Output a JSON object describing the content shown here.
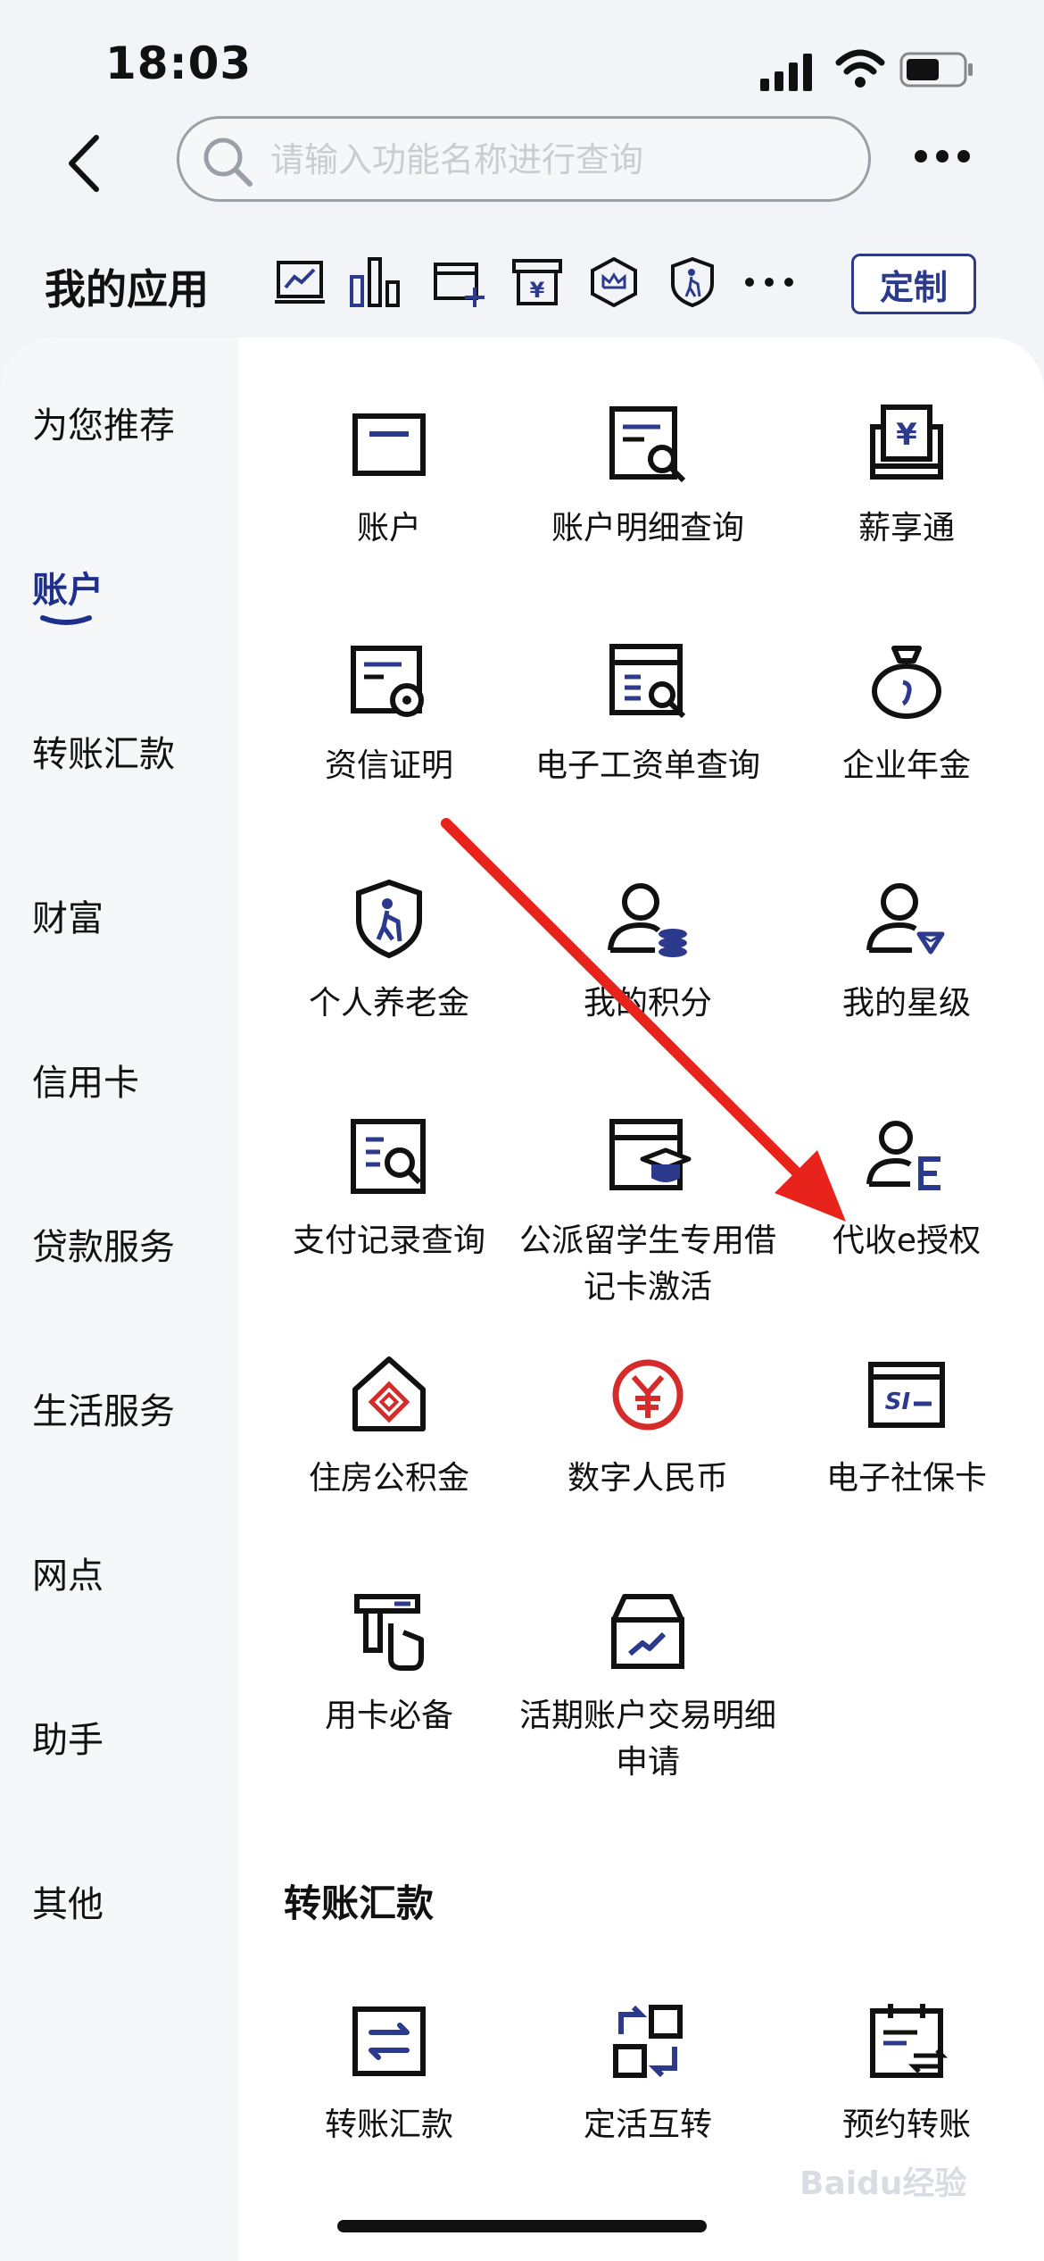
{
  "status": {
    "time": "18:03"
  },
  "search": {
    "placeholder": "请输入功能名称进行查询"
  },
  "my_apps": {
    "title": "我的应用",
    "customize": "定制"
  },
  "sidebar": {
    "items": [
      "为您推荐",
      "账户",
      "转账汇款",
      "财富",
      "信用卡",
      "贷款服务",
      "生活服务",
      "网点",
      "助手",
      "其他"
    ],
    "active": "账户"
  },
  "account_tiles": [
    "账户",
    "账户明细查询",
    "薪享通",
    "资信证明",
    "电子工资单查询",
    "企业年金",
    "个人养老金",
    "我的积分",
    "我的星级",
    "支付记录查询",
    "公派留学生专用借记卡激活",
    "代收e授权",
    "住房公积金",
    "数字人民币",
    "电子社保卡",
    "用卡必备",
    "活期账户交易明细申请"
  ],
  "transfer_section": {
    "title": "转账汇款",
    "tiles": [
      "转账汇款",
      "定活互转",
      "预约转账"
    ]
  },
  "colors": {
    "accent": "#2b3a8c",
    "arrow": "#e8231c",
    "icon": "#111111"
  },
  "watermark": "Baidu经验"
}
